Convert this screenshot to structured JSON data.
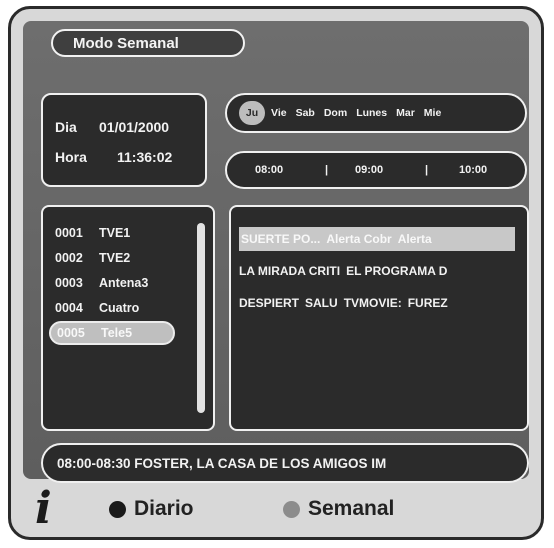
{
  "title": "Modo Semanal",
  "datetime": {
    "date_label": "Dia",
    "date_value": "01/01/2000",
    "time_label": "Hora",
    "time_value": "11:36:02"
  },
  "days": [
    {
      "label": "Ju",
      "selected": true
    },
    {
      "label": "Vie"
    },
    {
      "label": "Sab"
    },
    {
      "label": "Dom"
    },
    {
      "label": "Lunes"
    },
    {
      "label": "Mar"
    },
    {
      "label": "Mie"
    }
  ],
  "timeline": {
    "slots": [
      "08:00",
      "09:00",
      "10:00"
    ],
    "separator": "|"
  },
  "channels": [
    {
      "number": "0001",
      "name": "TVE1"
    },
    {
      "number": "0002",
      "name": "TVE2"
    },
    {
      "number": "0003",
      "name": "Antena3"
    },
    {
      "number": "0004",
      "name": "Cuatro"
    },
    {
      "number": "0005",
      "name": "Tele5",
      "selected": true
    }
  ],
  "programs": [
    {
      "cells": [
        "SUERTE PO...",
        "Alerta Cobr",
        "Alerta"
      ],
      "highlight": true
    },
    {
      "cells": [
        "LA MIRADA CRITI",
        "EL PROGRAMA D"
      ]
    },
    {
      "cells": [
        "DESPIERT",
        "SALU",
        "TVMOVIE:",
        "FUREZ"
      ]
    }
  ],
  "info_bar": "08:00-08:30 FOSTER, LA CASA DE LOS AMIGOS IM",
  "footer": {
    "info_icon": "info-icon",
    "diario_label": "Diario",
    "semanal_label": "Semanal"
  },
  "colors": {
    "screen_bg": "#666666",
    "panel_bg": "#2b2b2b",
    "diario_dot": "#1a1a1a",
    "semanal_dot": "#8c8c8c"
  }
}
